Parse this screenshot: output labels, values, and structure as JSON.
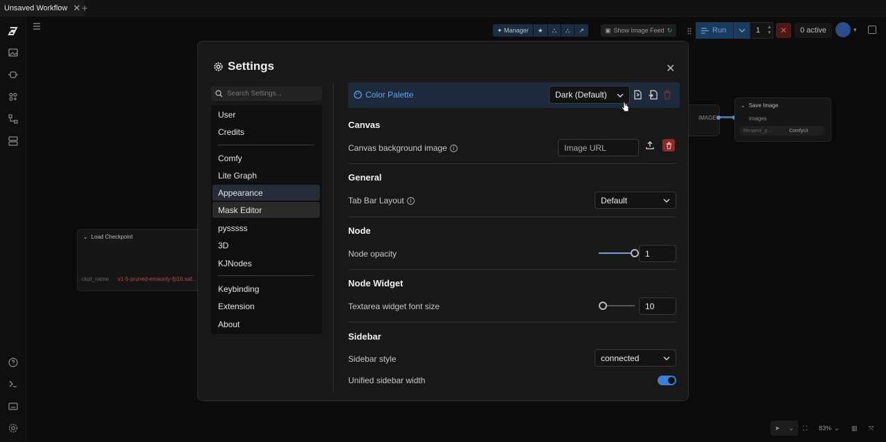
{
  "topbar": {
    "tab_title": "Unsaved Workflow",
    "close_glyph": "✕",
    "new_tab_glyph": "+"
  },
  "sidebar": {
    "icons": [
      "comfy-logo-icon",
      "images-icon",
      "nodes-icon",
      "models-icon",
      "workflows-icon",
      "templates-icon",
      "help-icon",
      "terminal-icon",
      "keyboard-icon",
      "settings-icon"
    ]
  },
  "toolbar": {
    "manager_label": "Manager",
    "show_image_feed_label": "Show Image Feed",
    "run_label": "Run",
    "queue_count": "1",
    "active_label": "0 active"
  },
  "nodes": {
    "load_checkpoint": {
      "title": "Load Checkpoint",
      "field": "ckpt_name",
      "value": "v1-5-pruned-emaonly-fp16.saf..."
    },
    "save_image": {
      "title": "Save Image",
      "input": "images",
      "field": "filename_p...",
      "value": "ComfyUI"
    },
    "mid": {
      "output": "IMAGE"
    }
  },
  "bottom_controls": {
    "zoom": "83%"
  },
  "settings": {
    "title": "Settings",
    "close_glyph": "✕",
    "search_placeholder": "Search Settings...",
    "menu": {
      "group1": [
        "User",
        "Credits"
      ],
      "group2": [
        "Comfy",
        "Lite Graph",
        "Appearance",
        "Mask Editor",
        "pysssss",
        "3D",
        "KJNodes"
      ],
      "group3": [
        "Keybinding",
        "Extension",
        "About"
      ]
    },
    "selected_item": "Appearance",
    "hovered_item": "Mask Editor",
    "color_palette": {
      "label": "Color Palette",
      "value": "Dark (Default)"
    },
    "sections": {
      "canvas": {
        "heading": "Canvas",
        "bg_label": "Canvas background image",
        "bg_placeholder": "Image URL"
      },
      "general": {
        "heading": "General",
        "tab_bar_label": "Tab Bar Layout",
        "tab_bar_value": "Default"
      },
      "node": {
        "heading": "Node",
        "opacity_label": "Node opacity",
        "opacity_value": "1",
        "opacity_fraction": 1.0
      },
      "node_widget": {
        "heading": "Node Widget",
        "font_label": "Textarea widget font size",
        "font_value": "10",
        "font_fraction": 0.0
      },
      "sidebar": {
        "heading": "Sidebar",
        "style_label": "Sidebar style",
        "style_value": "connected",
        "width_label": "Unified sidebar width",
        "width_on": true
      }
    }
  },
  "colors": {
    "accent": "#5ba6f2",
    "danger": "#c0393b",
    "selected_bg": "#262d38"
  }
}
